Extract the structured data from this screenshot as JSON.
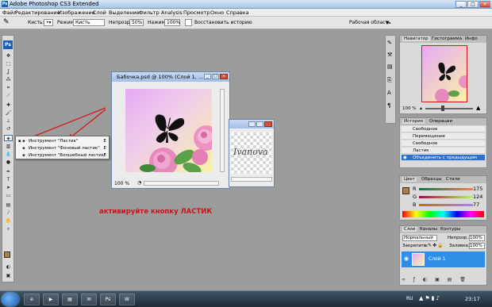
{
  "window": {
    "title": "Adobe Photoshop CS3 Extended",
    "app_icon": "Ps"
  },
  "menu": [
    "Файл",
    "Редактирование",
    "Изображение",
    "Слой",
    "Выделение",
    "Фильтр",
    "Analysis",
    "Просмотр",
    "Окно",
    "Справка"
  ],
  "options": {
    "brush_label": "Кисть:",
    "mode_label": "Режим:",
    "mode_value": "Кисть",
    "opacity_label": "Непрозр.:",
    "opacity_value": "50%",
    "flow_label": "Нажим:",
    "flow_value": "100%",
    "history_label": "Восстановить историю",
    "workspace_label": "Рабочая область"
  },
  "toolbox": {
    "logo": "Ps"
  },
  "document1": {
    "title": "Бабочка.psd @ 100% (Слой 1, ...",
    "zoom": "100 %"
  },
  "flyout": [
    {
      "label": "Инструмент \"Ластик\"",
      "shortcut": "E"
    },
    {
      "label": "Инструмент \"Фоновый ластик\"",
      "shortcut": "E"
    },
    {
      "label": "Инструмент \"Волшебный ластик\"",
      "shortcut": "E"
    }
  ],
  "caption": "активируйте кнопку ЛАСТИК",
  "watermark": "Ivanova",
  "navigator": {
    "tabs": [
      "Навигатор",
      "Гистограмма",
      "Инфо"
    ],
    "zoom": "100 %"
  },
  "history": {
    "tabs": [
      "История",
      "Операции"
    ],
    "items": [
      "Свободное Трансформирование",
      "Перемещение",
      "Свободное Трансформирование",
      "Ластик",
      "Объединить с предыдущим"
    ],
    "selected_index": 4
  },
  "color": {
    "tabs": [
      "Цвет",
      "Образцы",
      "Стили"
    ],
    "channels": [
      {
        "name": "R",
        "value": "175"
      },
      {
        "name": "G",
        "value": "124"
      },
      {
        "name": "B",
        "value": "77"
      }
    ],
    "foreground": "#af7c4d"
  },
  "layers": {
    "tabs": [
      "Слои",
      "Каналы",
      "Контуры"
    ],
    "blend": "Нормальный",
    "opacity_label": "Непрозр.:",
    "opacity_value": "100%",
    "lock_label": "Закрепить:",
    "fill_label": "Заливка:",
    "fill_value": "100%",
    "layer_name": "Слой 1"
  },
  "taskbar": {
    "lang": "RU",
    "time": "23:17"
  }
}
